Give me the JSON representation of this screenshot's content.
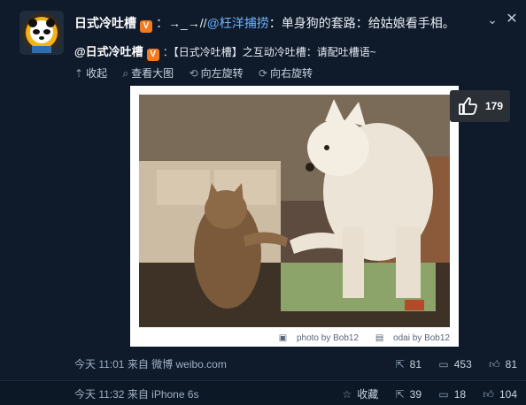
{
  "post": {
    "author": "日式冷吐槽",
    "separator": "：",
    "repost_arrows": "→_→//",
    "mention": "@枉洋捕捞",
    "text": "：单身狗的套路：给姑娘看手相。"
  },
  "forward": {
    "author": "@日式冷吐槽",
    "separator": "：",
    "text": "【日式冷吐槽】之互动冷吐槽：请配吐槽语~"
  },
  "actions": {
    "collapse": "收起",
    "view_large": "查看大图",
    "rotate_left": "向左旋转",
    "rotate_right": "向右旋转"
  },
  "photo": {
    "credit_photo": "photo by Bob12",
    "credit_odai": "odai by Bob12"
  },
  "like": {
    "count": "179"
  },
  "forward_meta": {
    "time": "今天 11:01",
    "source": "来自 微博 weibo.com",
    "reposts": "81",
    "comments": "453",
    "likes": "81"
  },
  "post_meta": {
    "time": "今天 11:32",
    "source": "来自 iPhone 6s",
    "favorite": "收藏",
    "reposts": "39",
    "comments": "18",
    "likes": "104"
  },
  "icons": {
    "up": "up-arrow-icon",
    "search": "search-icon",
    "rotate_left": "rotate-left-icon",
    "rotate_right": "rotate-right-icon",
    "repost": "repost-icon",
    "comment": "comment-icon",
    "like": "thumbs-up-icon",
    "favorite": "star-icon",
    "camera": "camera-icon",
    "image": "image-icon"
  },
  "colors": {
    "background": "#0f1a2a",
    "mention": "#6cb3ff",
    "badge": "#f47a20"
  }
}
